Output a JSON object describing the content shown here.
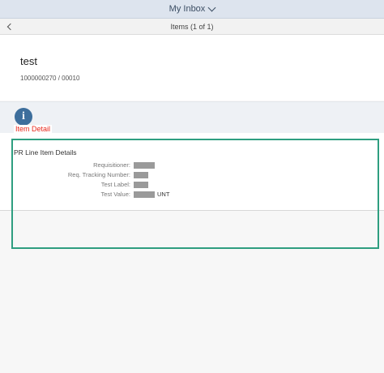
{
  "shell": {
    "title": "My Inbox"
  },
  "subheader": {
    "title": "Items (1 of 1)"
  },
  "object": {
    "title": "test",
    "number": "1000000270 / 00010"
  },
  "tabs": [
    {
      "label": "Item Detail",
      "icon": "info-icon",
      "icon_glyph": "i"
    }
  ],
  "section": {
    "title": "PR Line Item Details",
    "fields": [
      {
        "label": "Requisitioner:"
      },
      {
        "label": "Req. Tracking Number:"
      },
      {
        "label": "Test Label:"
      },
      {
        "label": "Test Value:",
        "unit": "UNT"
      }
    ]
  },
  "colors": {
    "accent": "#3d6e9c",
    "highlight": "#2e9e80",
    "tab_label": "#e8271b"
  }
}
